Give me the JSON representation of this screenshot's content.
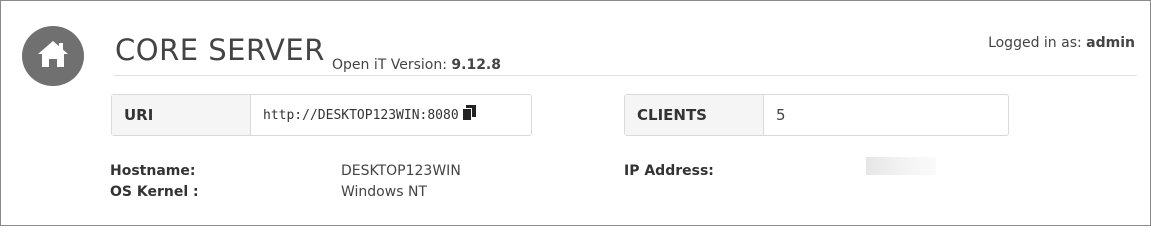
{
  "header": {
    "title": "CORE SERVER",
    "version_label": "Open iT Version: ",
    "version_value": "9.12.8",
    "logged_label": "Logged in as: ",
    "logged_user": "admin"
  },
  "uri": {
    "label": "URI",
    "value": "http://DESKTOP123WIN:8080"
  },
  "clients": {
    "label": "CLIENTS",
    "value": "5"
  },
  "info": {
    "hostname_label": "Hostname:",
    "hostname_value": "DESKTOP123WIN",
    "kernel_label": "OS Kernel :",
    "kernel_value": "Windows NT",
    "ip_label": "IP Address:"
  },
  "icons": {
    "home": "home-icon",
    "copy": "copy-icon"
  }
}
